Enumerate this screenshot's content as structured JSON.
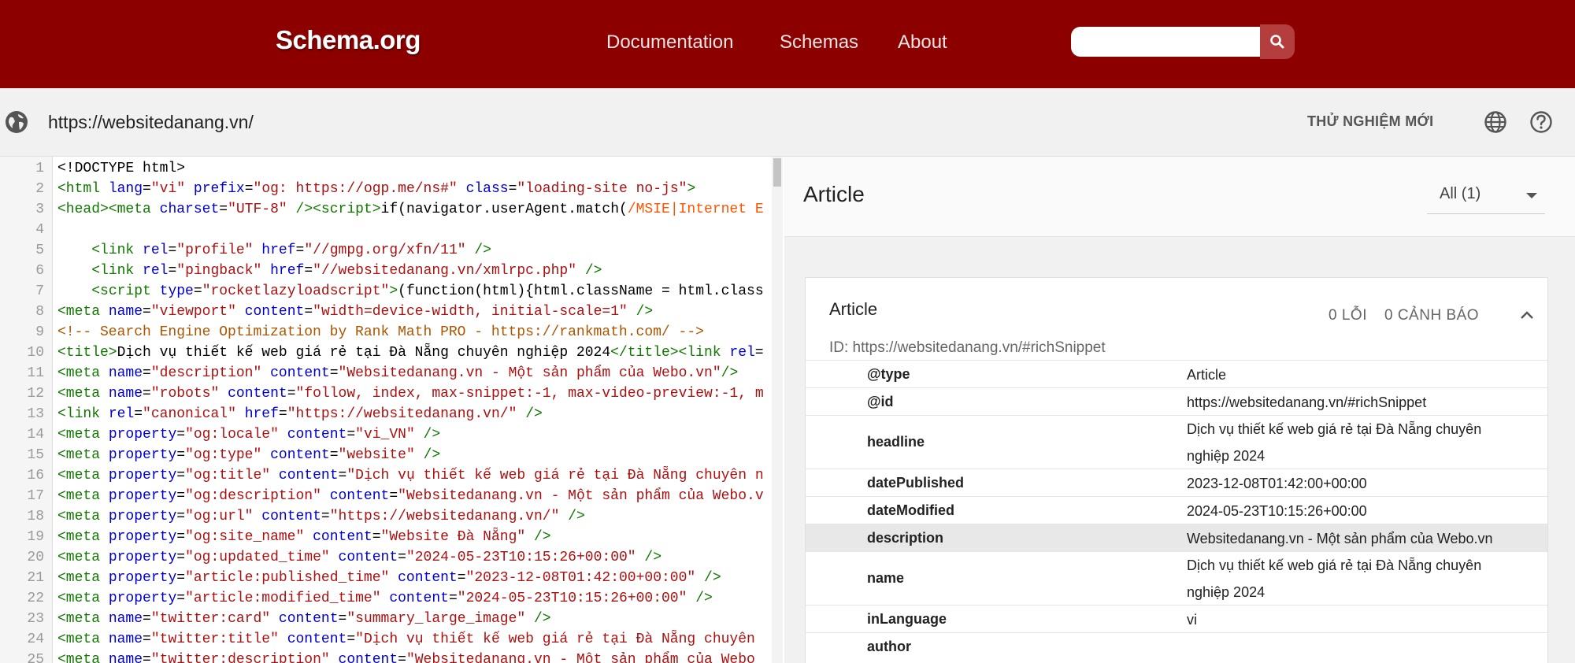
{
  "header": {
    "logo": "Schema.org",
    "nav": [
      "Documentation",
      "Schemas",
      "About"
    ],
    "search_placeholder": ""
  },
  "url_bar": {
    "url": "https://websitedanang.vn/",
    "try_new": "THỬ NGHIỆM MỚI"
  },
  "code": {
    "lines": [
      {
        "n": "1",
        "html": "&lt;!DOCTYPE html&gt;"
      },
      {
        "n": "2",
        "html": "<span class='t'>&lt;html</span> <span class='a'>lang</span>=<span class='s'>\"vi\"</span> <span class='a'>prefix</span>=<span class='s'>\"og: https://ogp.me/ns#\"</span> <span class='a'>class</span>=<span class='s'>\"loading-site no-js\"</span><span class='t'>&gt;</span>"
      },
      {
        "n": "3",
        "html": "<span class='t'>&lt;head&gt;&lt;meta</span> <span class='a'>charset</span>=<span class='s'>\"UTF-8\"</span> <span class='t'>/&gt;&lt;script&gt;</span>if(navigator.userAgent.match(<span class='r'>/MSIE|Internet E</span>"
      },
      {
        "n": "4",
        "html": ""
      },
      {
        "n": "5",
        "html": "    <span class='t'>&lt;link</span> <span class='a'>rel</span>=<span class='s'>\"profile\"</span> <span class='a'>href</span>=<span class='s'>\"//gmpg.org/xfn/11\"</span> <span class='t'>/&gt;</span>"
      },
      {
        "n": "6",
        "html": "    <span class='t'>&lt;link</span> <span class='a'>rel</span>=<span class='s'>\"pingback\"</span> <span class='a'>href</span>=<span class='s'>\"//websitedanang.vn/xmlrpc.php\"</span> <span class='t'>/&gt;</span>"
      },
      {
        "n": "7",
        "html": "    <span class='t'>&lt;script</span> <span class='a'>type</span>=<span class='s'>\"rocketlazyloadscript\"</span><span class='t'>&gt;</span>(function(html){html.className = html.class"
      },
      {
        "n": "8",
        "html": "<span class='t'>&lt;meta</span> <span class='a'>name</span>=<span class='s'>\"viewport\"</span> <span class='a'>content</span>=<span class='s'>\"width=device-width, initial-scale=1\"</span> <span class='t'>/&gt;</span>"
      },
      {
        "n": "9",
        "html": "<span class='c'>&lt;!-- Search Engine Optimization by Rank Math PRO - https://rankmath.com/ --&gt;</span>"
      },
      {
        "n": "10",
        "html": "<span class='t'>&lt;title&gt;</span>Dịch vụ thiết kế web giá rẻ tại Đà Nẵng chuyên nghiệp 2024<span class='t'>&lt;/title&gt;&lt;link</span> <span class='a'>rel</span>="
      },
      {
        "n": "11",
        "html": "<span class='t'>&lt;meta</span> <span class='a'>name</span>=<span class='s'>\"description\"</span> <span class='a'>content</span>=<span class='s'>\"Websitedanang.vn - Một sản phẩm của Webo.vn\"</span><span class='t'>/&gt;</span>"
      },
      {
        "n": "12",
        "html": "<span class='t'>&lt;meta</span> <span class='a'>name</span>=<span class='s'>\"robots\"</span> <span class='a'>content</span>=<span class='s'>\"follow, index, max-snippet:-1, max-video-preview:-1, m</span>"
      },
      {
        "n": "13",
        "html": "<span class='t'>&lt;link</span> <span class='a'>rel</span>=<span class='s'>\"canonical\"</span> <span class='a'>href</span>=<span class='s'>\"https://websitedanang.vn/\"</span> <span class='t'>/&gt;</span>"
      },
      {
        "n": "14",
        "html": "<span class='t'>&lt;meta</span> <span class='a'>property</span>=<span class='s'>\"og:locale\"</span> <span class='a'>content</span>=<span class='s'>\"vi_VN\"</span> <span class='t'>/&gt;</span>"
      },
      {
        "n": "15",
        "html": "<span class='t'>&lt;meta</span> <span class='a'>property</span>=<span class='s'>\"og:type\"</span> <span class='a'>content</span>=<span class='s'>\"website\"</span> <span class='t'>/&gt;</span>"
      },
      {
        "n": "16",
        "html": "<span class='t'>&lt;meta</span> <span class='a'>property</span>=<span class='s'>\"og:title\"</span> <span class='a'>content</span>=<span class='s'>\"Dịch vụ thiết kế web giá rẻ tại Đà Nẵng chuyên n</span>"
      },
      {
        "n": "17",
        "html": "<span class='t'>&lt;meta</span> <span class='a'>property</span>=<span class='s'>\"og:description\"</span> <span class='a'>content</span>=<span class='s'>\"Websitedanang.vn - Một sản phẩm của Webo.v</span>"
      },
      {
        "n": "18",
        "html": "<span class='t'>&lt;meta</span> <span class='a'>property</span>=<span class='s'>\"og:url\"</span> <span class='a'>content</span>=<span class='s'>\"https://websitedanang.vn/\"</span> <span class='t'>/&gt;</span>"
      },
      {
        "n": "19",
        "html": "<span class='t'>&lt;meta</span> <span class='a'>property</span>=<span class='s'>\"og:site_name\"</span> <span class='a'>content</span>=<span class='s'>\"Website Đà Nẵng\"</span> <span class='t'>/&gt;</span>"
      },
      {
        "n": "20",
        "html": "<span class='t'>&lt;meta</span> <span class='a'>property</span>=<span class='s'>\"og:updated_time\"</span> <span class='a'>content</span>=<span class='s'>\"2024-05-23T10:15:26+00:00\"</span> <span class='t'>/&gt;</span>"
      },
      {
        "n": "21",
        "html": "<span class='t'>&lt;meta</span> <span class='a'>property</span>=<span class='s'>\"article:published_time\"</span> <span class='a'>content</span>=<span class='s'>\"2023-12-08T01:42:00+00:00\"</span> <span class='t'>/&gt;</span>"
      },
      {
        "n": "22",
        "html": "<span class='t'>&lt;meta</span> <span class='a'>property</span>=<span class='s'>\"article:modified_time\"</span> <span class='a'>content</span>=<span class='s'>\"2024-05-23T10:15:26+00:00\"</span> <span class='t'>/&gt;</span>"
      },
      {
        "n": "23",
        "html": "<span class='t'>&lt;meta</span> <span class='a'>name</span>=<span class='s'>\"twitter:card\"</span> <span class='a'>content</span>=<span class='s'>\"summary_large_image\"</span> <span class='t'>/&gt;</span>"
      },
      {
        "n": "24",
        "html": "<span class='t'>&lt;meta</span> <span class='a'>name</span>=<span class='s'>\"twitter:title\"</span> <span class='a'>content</span>=<span class='s'>\"Dịch vụ thiết kế web giá rẻ tại Đà Nẵng chuyên</span>"
      },
      {
        "n": "25",
        "html": "<span class='t'>&lt;meta</span> <span class='a'>name</span>=<span class='s'>\"twitter:description\"</span> <span class='a'>content</span>=<span class='s'>\"Websitedanang.vn - Một sản phẩm của Webo</span>"
      }
    ]
  },
  "results": {
    "title": "Article",
    "filter": "All (1)",
    "card": {
      "title": "Article",
      "errors": "0 LỖI",
      "warnings": "0 CẢNH BÁO",
      "id": "ID: https://websitedanang.vn/#richSnippet",
      "properties": [
        {
          "key": "@type",
          "value": "Article"
        },
        {
          "key": "@id",
          "value": "https://websitedanang.vn/#richSnippet"
        },
        {
          "key": "headline",
          "value": "Dịch vụ thiết kế web giá rẻ tại Đà Nẵng chuyên nghiệp 2024"
        },
        {
          "key": "datePublished",
          "value": "2023-12-08T01:42:00+00:00"
        },
        {
          "key": "dateModified",
          "value": "2024-05-23T10:15:26+00:00"
        },
        {
          "key": "description",
          "value": "Websitedanang.vn - Một sản phẩm của Webo.vn"
        },
        {
          "key": "name",
          "value": "Dịch vụ thiết kế web giá rẻ tại Đà Nẵng chuyên nghiệp 2024"
        },
        {
          "key": "inLanguage",
          "value": "vi"
        },
        {
          "key": "author",
          "value": ""
        }
      ]
    }
  }
}
